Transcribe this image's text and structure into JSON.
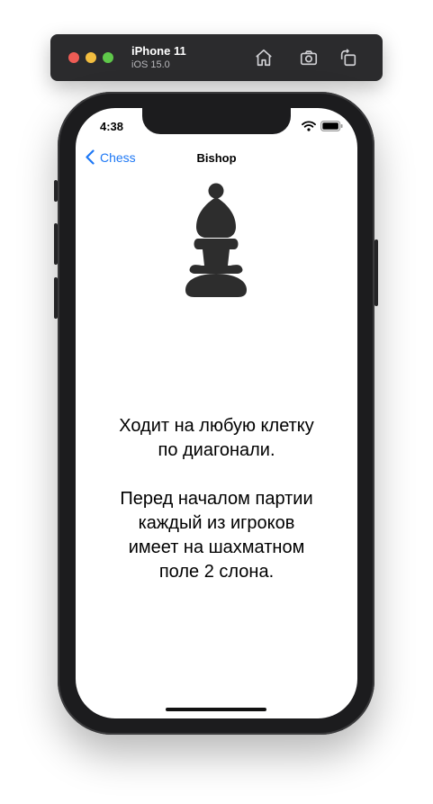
{
  "simulator": {
    "device_name": "iPhone 11",
    "os_version": "iOS 15.0",
    "toolbar_icons": [
      "home-icon",
      "screenshot-icon",
      "rotate-icon"
    ]
  },
  "status_bar": {
    "time": "4:38",
    "icons": [
      "wifi-icon",
      "battery-icon"
    ]
  },
  "nav": {
    "back_label": "Chess",
    "title": "Bishop"
  },
  "piece": {
    "name": "bishop-icon",
    "color": "#2d2d2d"
  },
  "description": {
    "paragraph1": [
      "Ходит на любую клетку",
      "по диагонали."
    ],
    "paragraph2": [
      "Перед началом партии",
      "каждый из игроков",
      "имеет на шахматном",
      "поле 2 слона."
    ]
  },
  "colors": {
    "accent": "#1e78f5",
    "toolbar_bg": "#2b2b2d",
    "phone_frame": "#1c1c1e"
  }
}
